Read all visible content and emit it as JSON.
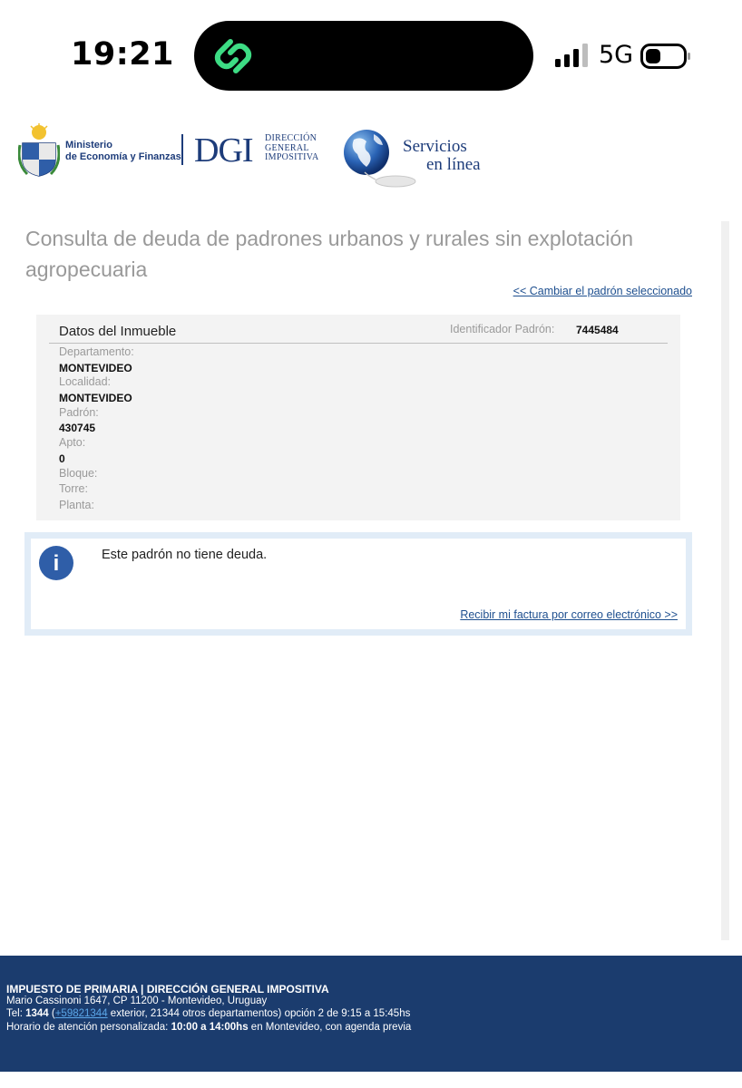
{
  "status_bar": {
    "time": "19:21",
    "network": "5G"
  },
  "header": {
    "ministry_line1": "Ministerio",
    "ministry_line2": "de Economía y Finanzas",
    "dgi_abbrev": "DGI",
    "dgi_line1": "Dirección",
    "dgi_line2": "General",
    "dgi_line3": "Impositiva",
    "services_line1": "Servicios",
    "services_line2": "en línea"
  },
  "main": {
    "title": "Consulta de deuda de padrones urbanos y rurales sin explotación agropecuaria",
    "change_link": "<< Cambiar el padrón seleccionado"
  },
  "inmueble": {
    "title": "Datos del Inmueble",
    "id_label": "Identificador Padrón:",
    "id_value": "7445484",
    "departamento_label": "Departamento:",
    "departamento_value": "MONTEVIDEO",
    "localidad_label": "Localidad:",
    "localidad_value": "MONTEVIDEO",
    "padron_label": "Padrón:",
    "padron_value": "430745",
    "apto_label": "Apto:",
    "apto_value": "0",
    "bloque_label": "Bloque:",
    "torre_label": "Torre:",
    "planta_label": "Planta:"
  },
  "info": {
    "icon_glyph": "i",
    "message": "Este padrón no tiene deuda.",
    "factura_link": "Recibir mi factura por correo electrónico >>"
  },
  "footer": {
    "title": "IMPUESTO DE PRIMARIA | DIRECCIÓN GENERAL IMPOSITIVA",
    "address": "Mario Cassinoni 1647, CP 11200 - Montevideo, Uruguay",
    "tel_prefix": "Tel: ",
    "tel_main": "1344",
    "tel_open": " (",
    "tel_link": "+59821344",
    "tel_rest": " exterior, 21344 otros departamentos) opción 2 de 9:15 a 15:45hs",
    "hours_prefix": "Horario de atención personalizada: ",
    "hours_bold": "10:00 a 14:00hs",
    "hours_rest": " en Montevideo, con agenda previa"
  },
  "colors": {
    "brand_blue": "#1b3c6e",
    "link_blue": "#1e4f8f",
    "title_gray": "#999999",
    "info_icon": "#2f5ea8",
    "island_accent": "#3ddc84"
  }
}
